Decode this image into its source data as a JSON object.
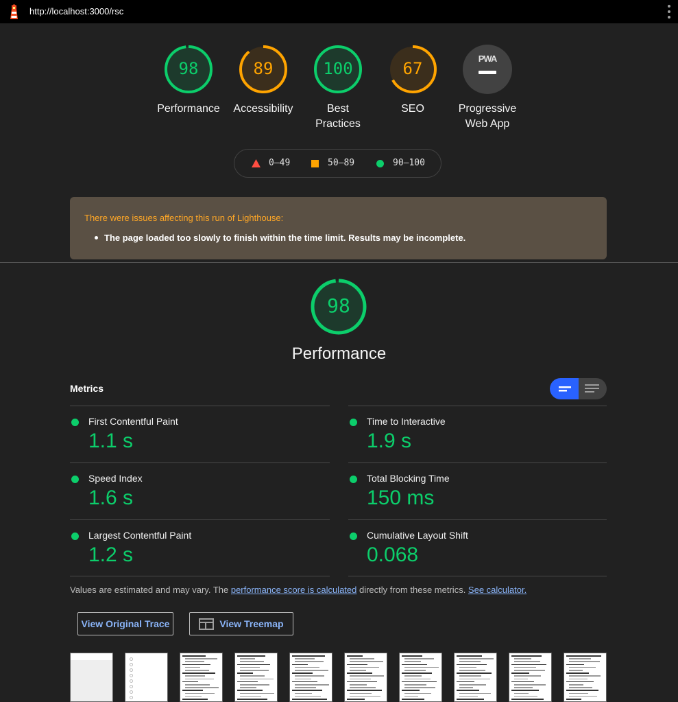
{
  "header": {
    "url": "http://localhost:3000/rsc",
    "logo_icon": "lighthouse-icon",
    "menu_icon": "kebab-menu-icon"
  },
  "gauges": [
    {
      "score": "98",
      "label_line1": "Performance",
      "label_line2": "",
      "color": "#0cce6b",
      "fill_fraction": 0.98
    },
    {
      "score": "89",
      "label_line1": "Accessibility",
      "label_line2": "",
      "color": "#ffa400",
      "fill_fraction": 0.89
    },
    {
      "score": "100",
      "label_line1": "Best",
      "label_line2": "Practices",
      "color": "#0cce6b",
      "fill_fraction": 1.0
    },
    {
      "score": "67",
      "label_line1": "SEO",
      "label_line2": "",
      "color": "#ffa400",
      "fill_fraction": 0.67
    }
  ],
  "pwa": {
    "badge_text": "PWA",
    "label_line1": "Progressive",
    "label_line2": "Web App"
  },
  "legend": {
    "fail": "0–49",
    "average": "50–89",
    "pass": "90–100"
  },
  "colors": {
    "pass": "#0cce6b",
    "average": "#ffa400",
    "fail": "#ff4e42",
    "warning_bg": "#5a5044",
    "link": "#8ab4f8",
    "toggle_active": "#2962ff"
  },
  "warning": {
    "title": "There were issues affecting this run of Lighthouse:",
    "item": "The page loaded too slowly to finish within the time limit. Results may be incomplete."
  },
  "performance": {
    "score": "98",
    "title": "Performance",
    "fill_fraction": 0.98
  },
  "metrics": {
    "header": "Metrics",
    "items": [
      {
        "name": "First Contentful Paint",
        "value": "1.1 s"
      },
      {
        "name": "Time to Interactive",
        "value": "1.9 s"
      },
      {
        "name": "Speed Index",
        "value": "1.6 s"
      },
      {
        "name": "Total Blocking Time",
        "value": "150 ms"
      },
      {
        "name": "Largest Contentful Paint",
        "value": "1.2 s"
      },
      {
        "name": "Cumulative Layout Shift",
        "value": "0.068"
      }
    ]
  },
  "note": {
    "prefix": "Values are estimated and may vary. The ",
    "link1": "performance score is calculated",
    "middle": " directly from these metrics. ",
    "link2": "See calculator."
  },
  "buttons": {
    "trace": "View Original Trace",
    "treemap": "View Treemap"
  }
}
